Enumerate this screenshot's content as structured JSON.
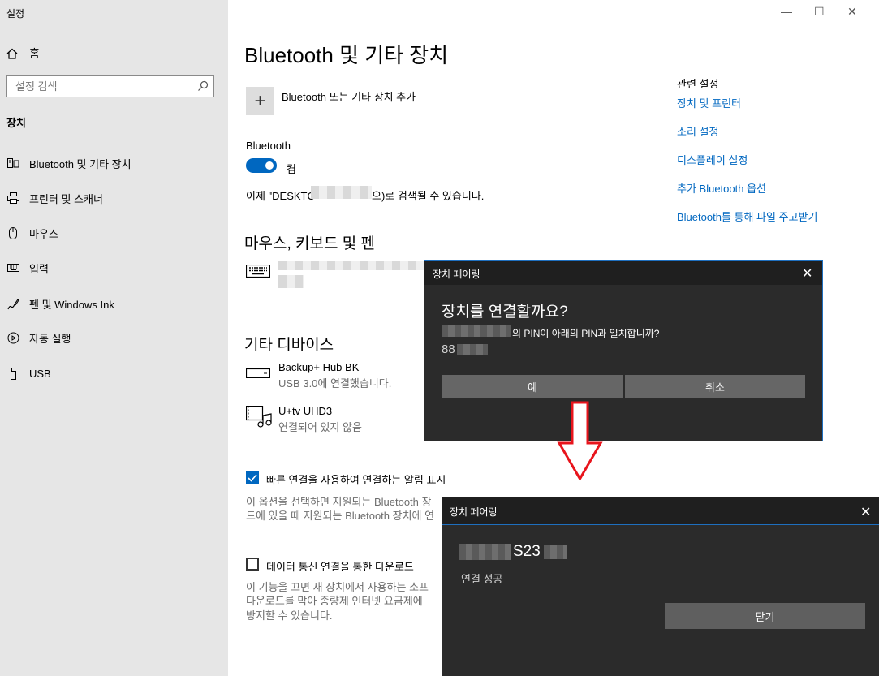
{
  "window": {
    "title": "설정",
    "minimize": "—",
    "maximize": "☐",
    "close": "✕"
  },
  "sidebar": {
    "home": "홈",
    "search_placeholder": "설정 검색",
    "category": "장치",
    "items": [
      {
        "label": "Bluetooth 및 기타 장치",
        "icon": "bluetooth-devices-icon"
      },
      {
        "label": "프린터 및 스캐너",
        "icon": "printer-icon"
      },
      {
        "label": "마우스",
        "icon": "mouse-icon"
      },
      {
        "label": "입력",
        "icon": "keyboard-icon"
      },
      {
        "label": "펜 및 Windows Ink",
        "icon": "pen-icon"
      },
      {
        "label": "자동 실행",
        "icon": "autoplay-icon"
      },
      {
        "label": "USB",
        "icon": "usb-icon"
      }
    ]
  },
  "main": {
    "title": "Bluetooth 및 기타 장치",
    "add_device": "Bluetooth 또는 기타 장치 추가",
    "bluetooth_label": "Bluetooth",
    "toggle_state": "켬",
    "discoverable_prefix": "이제 \"DESKTC",
    "discoverable_suffix": "으)로 검색될 수 있습니다.",
    "mouse_section": "마우스, 키보드 및 펜",
    "other_section": "기타 디바이스",
    "other_devices": [
      {
        "name": "Backup+ Hub BK",
        "status": "USB 3.0에 연결했습니다."
      },
      {
        "name": "U+tv UHD3",
        "status": "연결되어 있지 않음"
      }
    ],
    "swift_pair_label": "빠른 연결을 사용하여 연결하는 알림 표시",
    "swift_pair_desc1": "이 옵션을 선택하면 지원되는 Bluetooth 장",
    "swift_pair_desc2": "드에 있을 때 지원되는 Bluetooth 장치에 연",
    "metered_label": "데이터 통신 연결을 통한 다운로드",
    "metered_desc1": "이 기능을 끄면 새 장치에서 사용하는 소프",
    "metered_desc2": "다운로드를 막아 종량제 인터넷 요금제에 ",
    "metered_desc3": "방지할 수 있습니다."
  },
  "related": {
    "title": "관련 설정",
    "links": [
      "장치 및 프린터",
      "소리 설정",
      "디스플레이 설정",
      "추가 Bluetooth 옵션",
      "Bluetooth를 통해 파일 주고받기"
    ]
  },
  "dialog1": {
    "title": "장치 페어링",
    "heading": "장치를 연결할까요?",
    "message": "의 PIN이 아래의 PIN과 일치합니까?",
    "pin": "88",
    "yes": "예",
    "cancel": "취소"
  },
  "dialog2": {
    "title": "장치 페어링",
    "device": "S23",
    "status": "연결 성공",
    "close": "닫기"
  },
  "colors": {
    "accent": "#0067c0",
    "arrow": "#e8141c"
  }
}
